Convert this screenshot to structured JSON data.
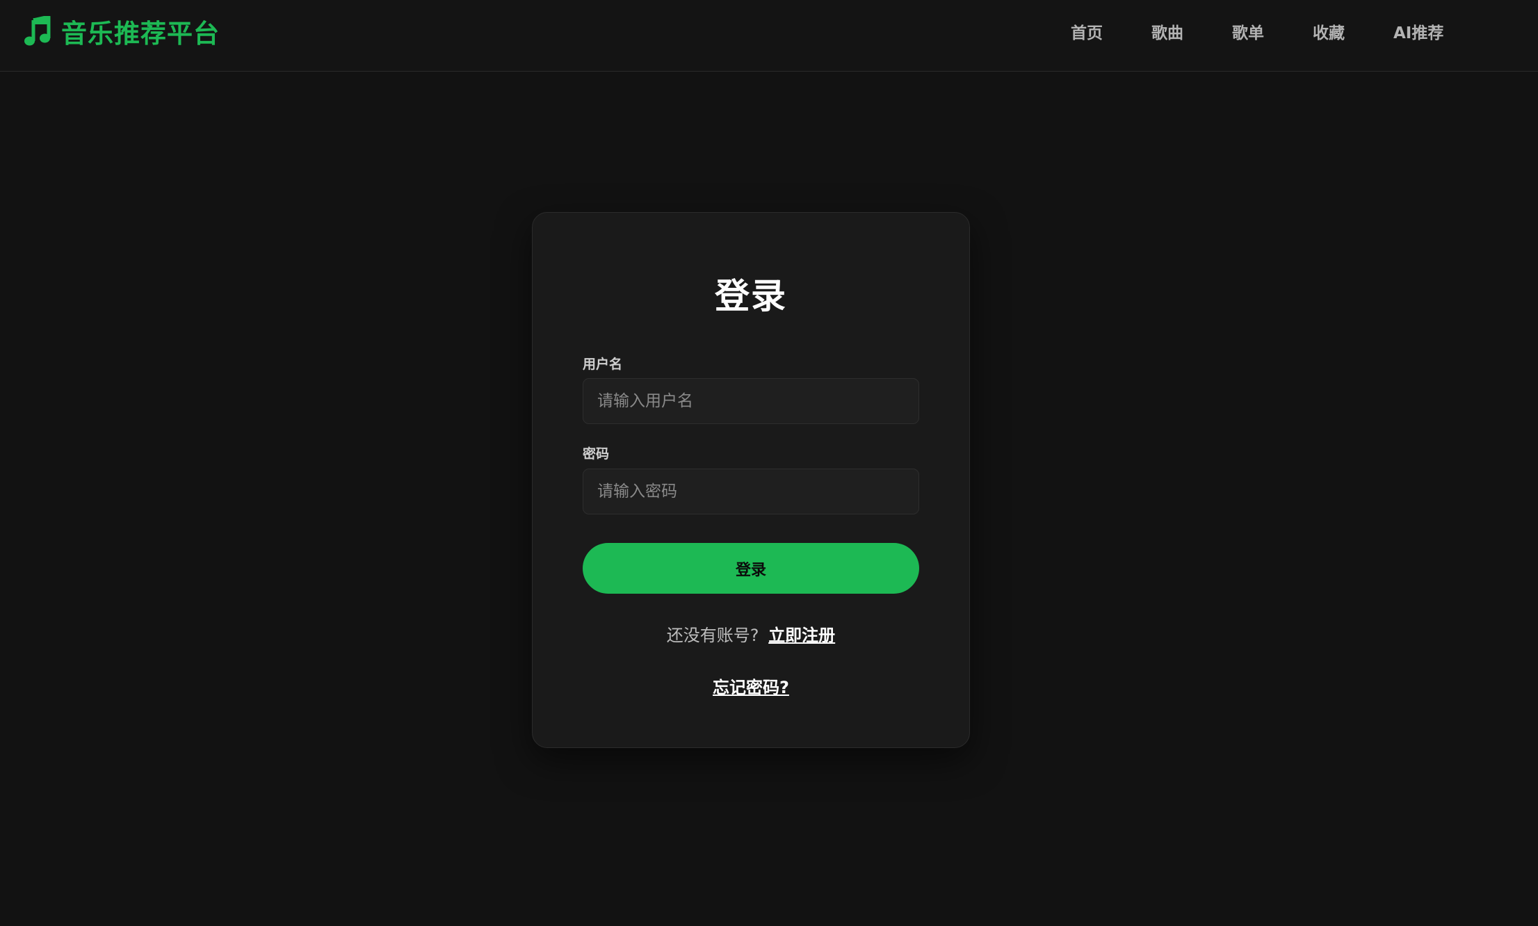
{
  "header": {
    "brand_icon": "music-note-icon",
    "brand_title": "音乐推荐平台",
    "accent_color": "#1db954",
    "nav": [
      {
        "label": "首页"
      },
      {
        "label": "歌曲"
      },
      {
        "label": "歌单"
      },
      {
        "label": "收藏"
      },
      {
        "label": "AI推荐"
      }
    ]
  },
  "login": {
    "title": "登录",
    "username_label": "用户名",
    "username_value": "",
    "username_placeholder": "请输入用户名",
    "password_label": "密码",
    "password_value": "",
    "password_placeholder": "请输入密码",
    "submit_label": "登录",
    "no_account_text": "还没有账号?",
    "register_link": "立即注册",
    "forgot_link": "忘记密码?"
  }
}
